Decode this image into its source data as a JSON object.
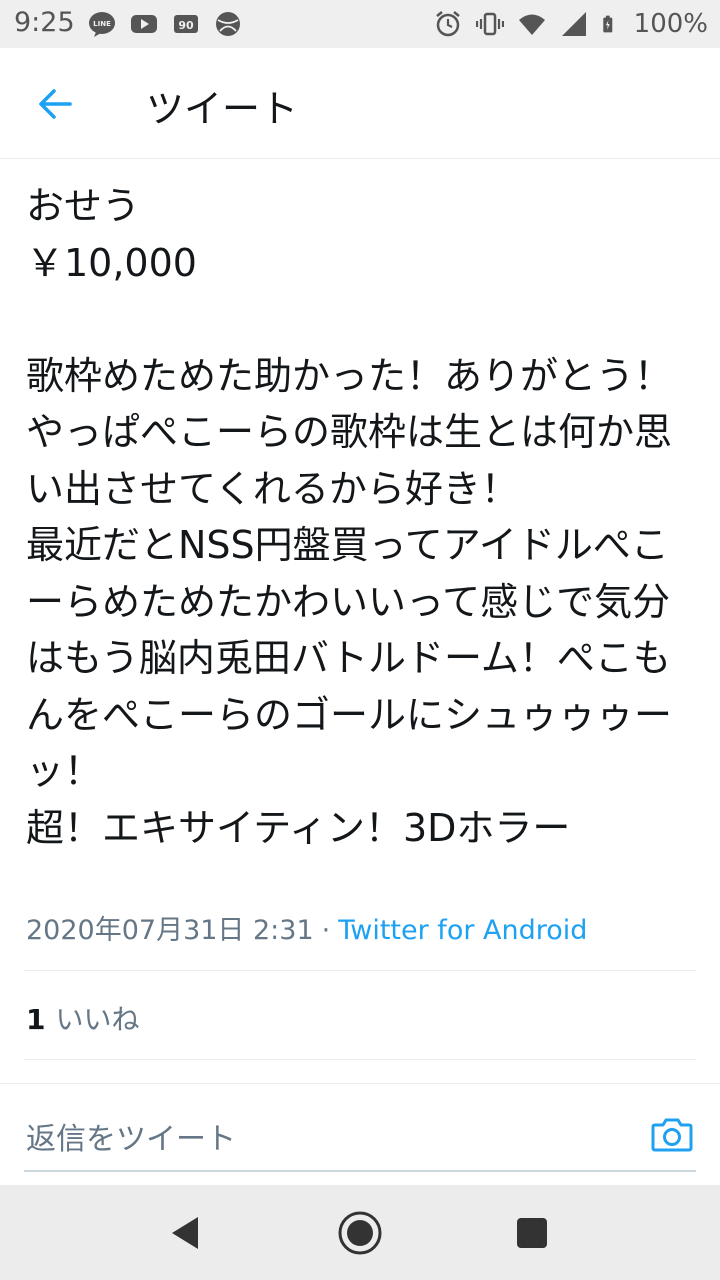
{
  "status_bar": {
    "time": "9:25",
    "left_icons": [
      "line-icon",
      "youtube-icon",
      "app-icon",
      "sports-icon"
    ],
    "right_icons": [
      "alarm-icon",
      "vibrate-icon",
      "wifi-icon",
      "signal-icon",
      "battery-icon"
    ],
    "battery": "100%"
  },
  "header": {
    "back_icon": "back-arrow-icon",
    "title": "ツイート"
  },
  "tweet": {
    "text": "おせう\n￥10,000\n\n歌枠めためた助かった！ありがとう！やっぱぺこーらの歌枠は生とは何か思い出させてくれるから好き！\n最近だとNSS円盤買ってアイドルぺこーらめためたかわいいって感じで気分はもう脳内兎田バトルドーム！ぺこもんをぺこーらのゴールにシュゥゥゥーッ！\n超！エキサイティン！3Dホラー",
    "timestamp": "2020年07月31日 2:31",
    "separator": "·",
    "source": "Twitter for Android"
  },
  "likes": {
    "count": "1",
    "label": "いいね"
  },
  "reply": {
    "placeholder": "返信をツイート",
    "camera_icon": "camera-icon"
  },
  "nav_bar": {
    "buttons": [
      "back-triangle-icon",
      "home-circle-icon",
      "recents-square-icon"
    ]
  },
  "colors": {
    "accent": "#1da1f2",
    "text": "#14171a",
    "secondary": "#657786"
  }
}
